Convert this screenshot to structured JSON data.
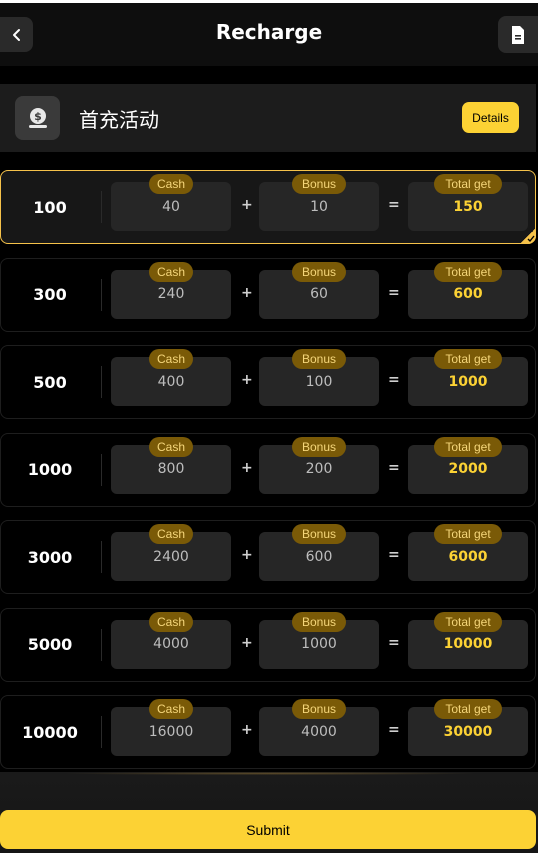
{
  "header": {
    "title": "Recharge",
    "back_icon": "chevron-left-icon",
    "record_icon": "document-icon"
  },
  "promo": {
    "icon": "money-bag-icon",
    "text": "首充活动",
    "details_label": "Details"
  },
  "labels": {
    "cash": "Cash",
    "bonus": "Bonus",
    "total": "Total get",
    "plus": "+",
    "equals": "="
  },
  "options": [
    {
      "amount": "100",
      "cash": "40",
      "bonus": "10",
      "total": "150",
      "selected": true
    },
    {
      "amount": "300",
      "cash": "240",
      "bonus": "60",
      "total": "600",
      "selected": false
    },
    {
      "amount": "500",
      "cash": "400",
      "bonus": "100",
      "total": "1000",
      "selected": false
    },
    {
      "amount": "1000",
      "cash": "800",
      "bonus": "200",
      "total": "2000",
      "selected": false
    },
    {
      "amount": "3000",
      "cash": "2400",
      "bonus": "600",
      "total": "6000",
      "selected": false
    },
    {
      "amount": "5000",
      "cash": "4000",
      "bonus": "1000",
      "total": "10000",
      "selected": false
    },
    {
      "amount": "10000",
      "cash": "16000",
      "bonus": "4000",
      "total": "30000",
      "selected": false
    }
  ],
  "submit_label": "Submit",
  "colors": {
    "accent": "#fcd234",
    "tag_bg": "#7a5a07",
    "box_bg": "#262626"
  }
}
